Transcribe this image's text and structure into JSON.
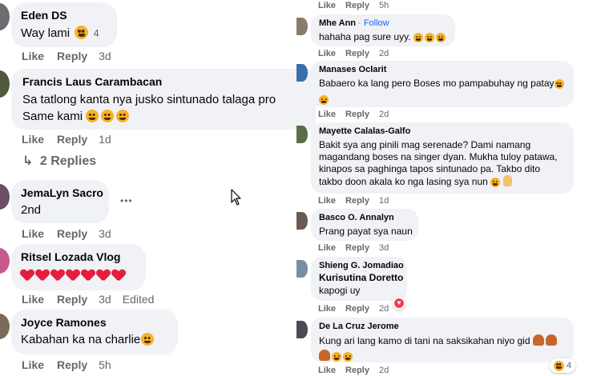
{
  "left": {
    "actions": {
      "like": "Like",
      "reply": "Reply"
    },
    "comments": [
      {
        "name": "Eden DS",
        "lines": [
          "Way lami"
        ],
        "reaction_count": "4",
        "time": "3d"
      },
      {
        "name": "Francis Laus Carambacan",
        "lines": [
          "Sa tatlong kanta nya jusko sintunado talaga pro",
          "Same kami"
        ],
        "time": "1d"
      },
      {
        "name": "JemaLyn Sacro",
        "lines": [
          "2nd"
        ],
        "time": "3d",
        "more_label": "•••"
      },
      {
        "name": "Ritsel Lozada Vlog",
        "lines": [
          ""
        ],
        "time": "3d",
        "edited": "Edited"
      },
      {
        "name": "Joyce Ramones",
        "lines": [
          "Kabahan ka na charlie"
        ],
        "time": "5h"
      }
    ],
    "replies_label": "2 Replies",
    "replies_arrow": "↳"
  },
  "right": {
    "actions": {
      "like": "Like",
      "reply": "Reply"
    },
    "top_time": "5h",
    "comments": [
      {
        "name": "Mhe Ann",
        "follow": "Follow",
        "lines": [
          "hahaha pag sure uyy."
        ],
        "time": "2d"
      },
      {
        "name": "Manases Oclarit",
        "lines": [
          "Babaero ka lang pero Boses mo pampabuhay ng patay"
        ],
        "time": "2d"
      },
      {
        "name": "Mayette Calalas-Galfo",
        "lines": [
          "Bakit sya ang pinili mag serenade? Dami namang",
          "magandang boses na singer dyan. Mukha tuloy patawa,",
          "kinapos sa paghinga tapos sintunado pa. Takbo dito",
          "takbo doon akala ko nga lasing sya nun"
        ],
        "time": "1d"
      },
      {
        "name": "Basco O. Annalyn",
        "lines": [
          "Prang payat sya naun"
        ],
        "time": "3d"
      },
      {
        "name": "Shieng G. Jomadiao",
        "subname": "Kurisutina Doretto",
        "lines": [
          "kapogi uy"
        ],
        "time": "2d"
      },
      {
        "name": "De La Cruz Jerome",
        "lines": [
          "Kung ari lang kamo di tani na saksikahan niyo gid"
        ],
        "time": "2d",
        "reaction_count": "4"
      }
    ]
  },
  "colors": {
    "bubble": "#f0f2f5",
    "meta": "#65676b",
    "follow": "#0866ff",
    "heart": "#e41e3f"
  }
}
